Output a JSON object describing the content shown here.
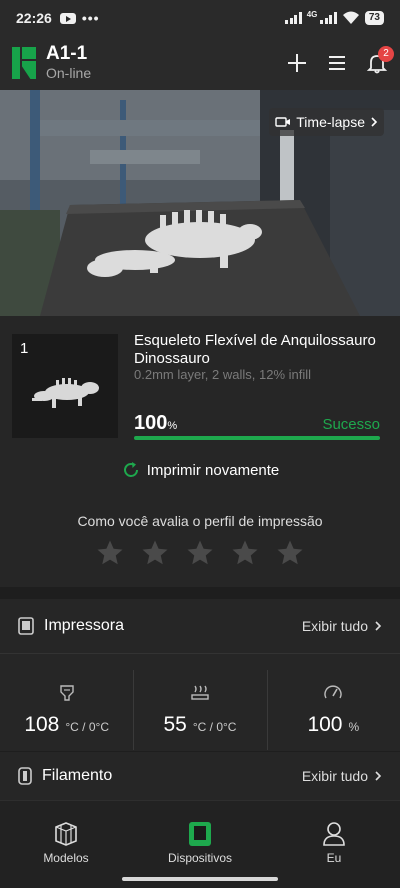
{
  "status_bar": {
    "time": "22:26",
    "dots": "•••",
    "network": "4G",
    "battery": "73"
  },
  "header": {
    "device_name": "A1-1",
    "device_status": "On-line",
    "notification_count": "2",
    "icons": [
      "add-icon",
      "menu-icon",
      "bell-icon"
    ]
  },
  "camera": {
    "timelapse_label": "Time-lapse"
  },
  "job": {
    "plate_number": "1",
    "title": "Esqueleto Flexível de Anquilossauro Dinossauro",
    "settings": "0.2mm layer, 2 walls, 12% infill",
    "progress_value": "100",
    "progress_unit": "%",
    "progress_fraction": 1.0,
    "status": "Sucesso",
    "reprint_label": "Imprimir novamente",
    "rating_question": "Como você avalia o perfil de impressão",
    "rating_stars_total": 5,
    "rating_stars_filled": 0
  },
  "printer": {
    "title": "Impressora",
    "link": "Exibir tudo",
    "nozzle": {
      "value": "108",
      "unit": "°C / 0°C"
    },
    "bed": {
      "value": "55",
      "unit": "°C / 0°C"
    },
    "fan": {
      "value": "100",
      "unit": "%"
    }
  },
  "filament": {
    "title": "Filamento",
    "link": "Exibir tudo"
  },
  "tabs": [
    {
      "label": "Modelos",
      "icon": "cubes-icon"
    },
    {
      "label": "Dispositivos",
      "icon": "printer-icon",
      "active": true
    },
    {
      "label": "Eu",
      "icon": "user-icon"
    }
  ],
  "colors": {
    "accent_green": "#1ea84d",
    "logo_green": "#17a34a",
    "badge_red": "#e54545",
    "background": "#1e1e1e"
  }
}
